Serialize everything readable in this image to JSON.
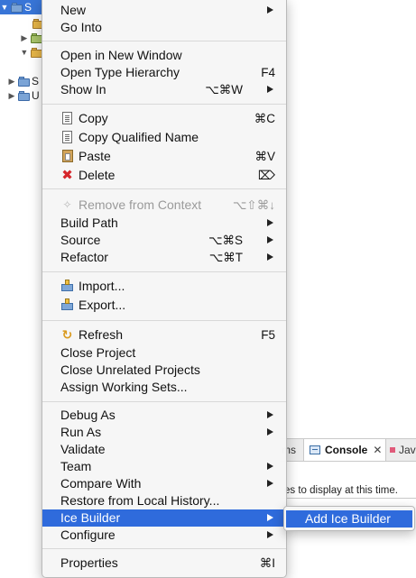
{
  "tree": {
    "rows": [
      {
        "text": "S",
        "selected": true
      },
      {
        "text": "",
        "selected": false
      },
      {
        "text": "",
        "selected": false
      },
      {
        "text": "",
        "selected": false
      },
      {
        "text": "S",
        "selected": false
      },
      {
        "text": "U",
        "selected": false
      }
    ]
  },
  "views": {
    "problems_tab_fragment": "ms",
    "console_tab": "Console",
    "java_tab_fragment": "Jav",
    "console_message": "es to display at this time."
  },
  "menu": {
    "new": "New",
    "go_into": "Go Into",
    "open_new_window": "Open in New Window",
    "open_type_hierarchy": "Open Type Hierarchy",
    "open_type_hierarchy_sc": "F4",
    "show_in": "Show In",
    "show_in_sc": "⌥⌘W",
    "copy": "Copy",
    "copy_sc": "⌘C",
    "copy_qualified": "Copy Qualified Name",
    "paste": "Paste",
    "paste_sc": "⌘V",
    "delete": "Delete",
    "delete_sc": "⌦",
    "remove_context": "Remove from Context",
    "remove_context_sc": "⌥⇧⌘↓",
    "build_path": "Build Path",
    "source": "Source",
    "source_sc": "⌥⌘S",
    "refactor": "Refactor",
    "refactor_sc": "⌥⌘T",
    "import": "Import...",
    "export": "Export...",
    "refresh": "Refresh",
    "refresh_sc": "F5",
    "close_project": "Close Project",
    "close_unrelated": "Close Unrelated Projects",
    "assign_working_sets": "Assign Working Sets...",
    "debug_as": "Debug As",
    "run_as": "Run As",
    "validate": "Validate",
    "team": "Team",
    "compare_with": "Compare With",
    "restore_history": "Restore from Local History...",
    "ice_builder": "Ice Builder",
    "configure": "Configure",
    "properties": "Properties",
    "properties_sc": "⌘I"
  },
  "submenu": {
    "add_ice_builder": "Add Ice Builder"
  },
  "colors": {
    "highlight": "#2f6bdc",
    "selection": "#3875d7"
  }
}
